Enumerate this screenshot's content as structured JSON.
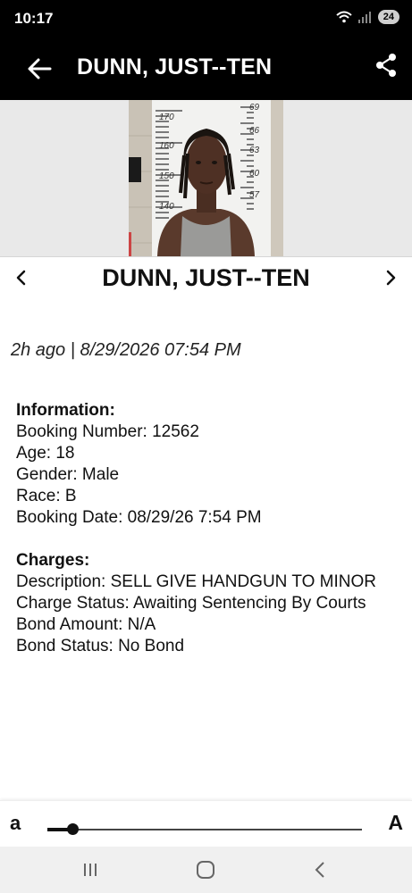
{
  "status_bar": {
    "time": "10:17",
    "battery": "24"
  },
  "app_bar": {
    "title": "DUNN, JUST--TEN"
  },
  "mugshot": {
    "height_marks": [
      "170",
      "160",
      "150",
      "140",
      "69",
      "66",
      "63",
      "60",
      "57"
    ]
  },
  "record": {
    "name": "DUNN, JUST--TEN",
    "timestamp": "2h ago | 8/29/2026 07:54 PM",
    "information_heading": "Information:",
    "booking_number": "Booking Number: 12562",
    "age": "Age: 18",
    "gender": "Gender: Male",
    "race": "Race: B",
    "booking_date": "Booking Date: 08/29/26 7:54 PM",
    "charges_heading": "Charges:",
    "description": "Description: SELL GIVE HANDGUN TO MINOR",
    "charge_status": "Charge Status: Awaiting Sentencing By Courts",
    "bond_amount": "Bond Amount: N/A",
    "bond_status": "Bond Status: No Bond"
  },
  "font_size_control": {
    "small_label": "a",
    "large_label": "A",
    "level": 0.08
  },
  "icons": {
    "back": "back-arrow-icon",
    "share": "share-icon",
    "prev": "chevron-left-icon",
    "next": "chevron-right-icon"
  },
  "colors": {
    "app_bar": "#000000",
    "text": "#111111"
  }
}
